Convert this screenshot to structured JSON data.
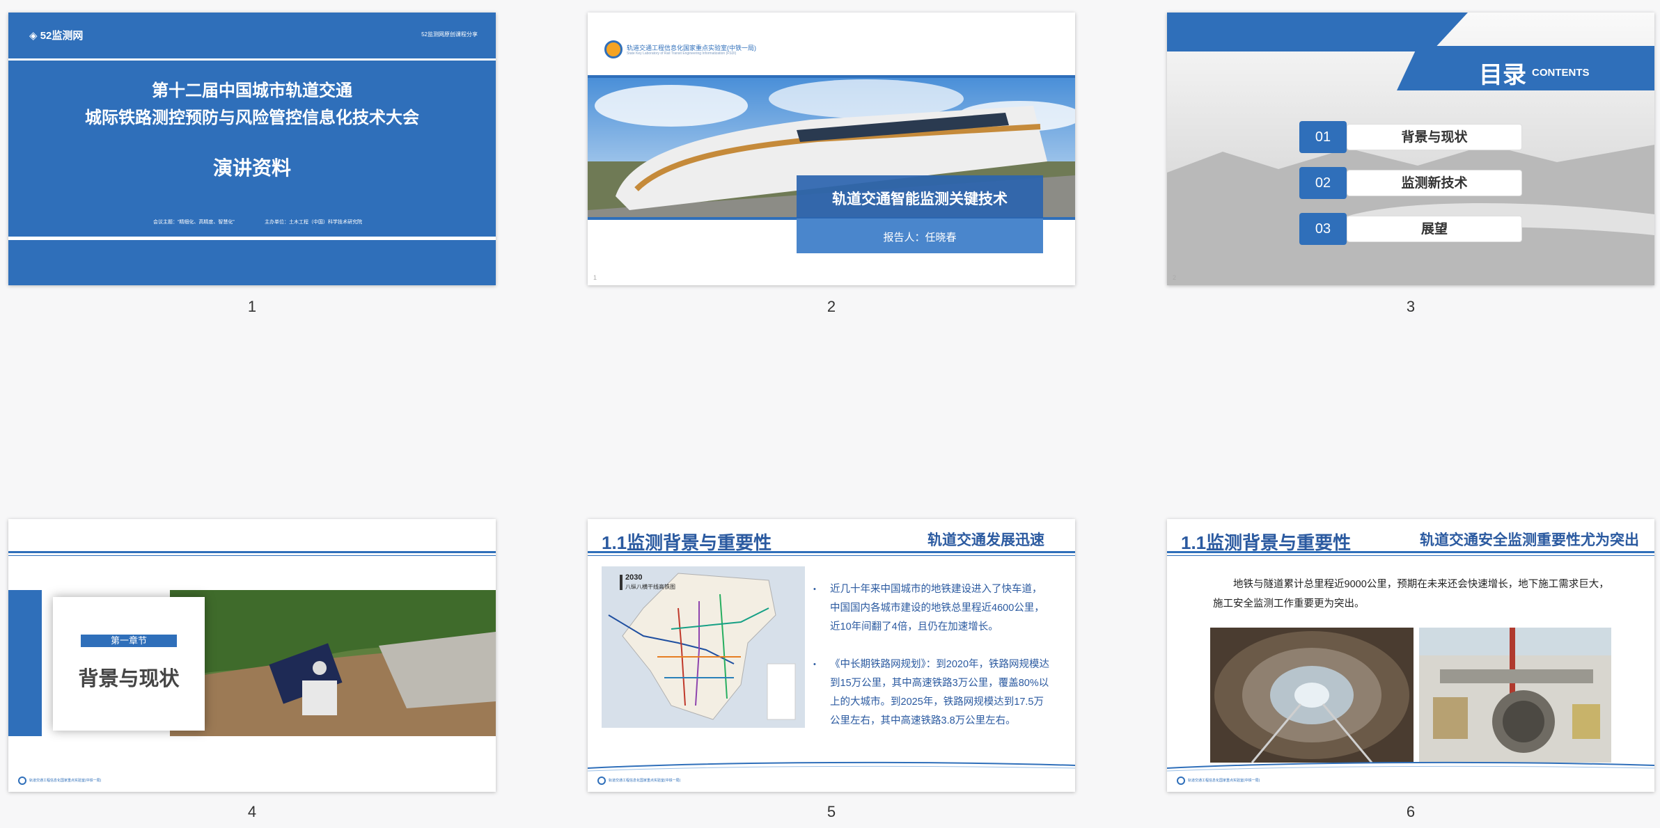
{
  "colors": {
    "accent": "#2f6fba",
    "dark_accent": "#2b5aa0",
    "bg": "#f7f7f8"
  },
  "slides": [
    {
      "number": "1",
      "logo": "52监测网",
      "top_right": "52监测网原创课程分享",
      "title_line1": "第十二届中国城市轨道交通",
      "title_line2": "城际铁路测控预防与风险管控信息化技术大会",
      "subtitle": "演讲资料",
      "footer_left": "会议主题：“精细化、高精度、智慧化”",
      "footer_right": "主办单位：土木工程（中国）科学技术研究院"
    },
    {
      "number": "2",
      "org_name": "轨道交通工程信息化国家重点实验室(中铁一局)",
      "org_sub": "State Key Laboratory of Rail Transit Engineering Informatization (FSDI)",
      "title": "轨道交通智能监测关键技术",
      "reporter": "报告人：任晓春",
      "page": "1"
    },
    {
      "number": "3",
      "title": "目录",
      "title_en": "CONTENTS",
      "items": [
        {
          "index": "01",
          "label": "背景与现状"
        },
        {
          "index": "02",
          "label": "监测新技术"
        },
        {
          "index": "03",
          "label": "展望"
        }
      ],
      "page": "2"
    },
    {
      "number": "4",
      "chapter": "第一章节",
      "title": "背景与现状",
      "footer": "轨道交通工程信息化国家重点实验室(中铁一局)"
    },
    {
      "number": "5",
      "title": "1.1监测背景与重要性",
      "right_title": "轨道交通发展迅速",
      "map_year": "2030",
      "map_sub": "八纵八横干线高铁图",
      "bullets": [
        "近几十年来中国城市的地铁建设进入了快车道，中国国内各城市建设的地铁总里程近4600公里，近10年间翻了4倍，且仍在加速增长。",
        "《中长期铁路网规划》：到2020年，铁路网规模达到15万公里，其中高速铁路3万公里，覆盖80%以上的大城市。到2025年，铁路网规模达到17.5万公里左右，其中高速铁路3.8万公里左右。"
      ],
      "footer": "轨道交通工程信息化国家重点实验室(中铁一局)"
    },
    {
      "number": "6",
      "title": "1.1监测背景与重要性",
      "right_title": "轨道交通安全监测重要性尤为突出",
      "body": "地铁与隧道累计总里程近9000公里，预期在未来还会快速增长，地下施工需求巨大，施工安全监测工作重要更为突出。",
      "footer": "轨道交通工程信息化国家重点实验室(中铁一局)"
    }
  ]
}
